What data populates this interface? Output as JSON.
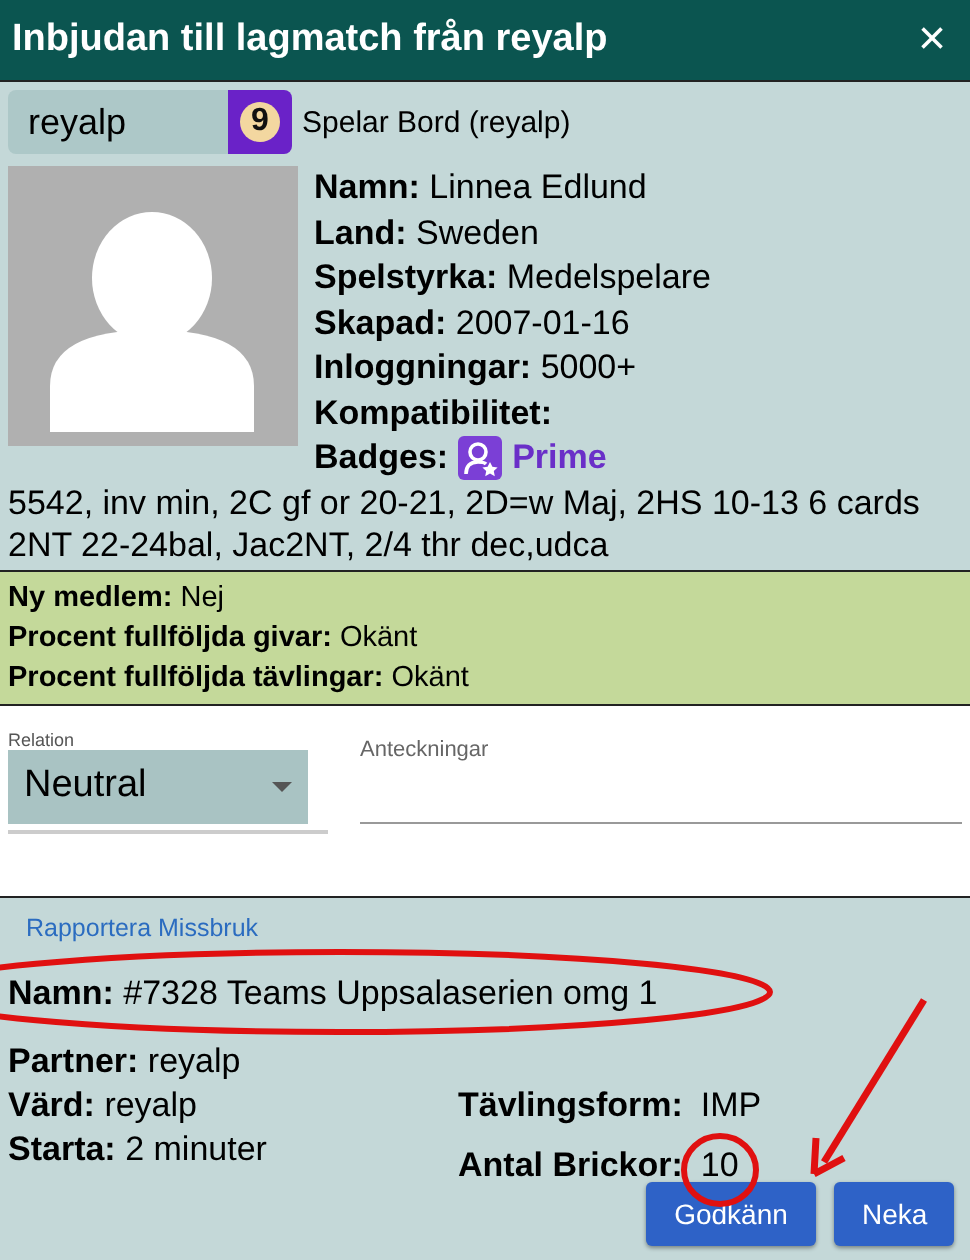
{
  "window": {
    "title": "Inbjudan till lagmatch från reyalp",
    "close": "×"
  },
  "host": {
    "username": "reyalp",
    "level_badge": "9",
    "status": "Spelar Bord (reyalp)"
  },
  "profile": {
    "fields": [
      {
        "label": "Namn:",
        "value": "Linnea Edlund"
      },
      {
        "label": "Land:",
        "value": "Sweden"
      },
      {
        "label": "Spelstyrka:",
        "value": "Medelspelare"
      },
      {
        "label": "Skapad:",
        "value": "2007-01-16"
      },
      {
        "label": "Inloggningar:",
        "value": "5000+"
      },
      {
        "label": "Kompatibilitet:"
      }
    ],
    "badges": {
      "label": "Badges:",
      "name": "Prime"
    },
    "bio": [
      "5542, inv min, 2C gf or 20-21, 2D=w Maj, 2HS 10-13 6 cards",
      "2NT 22-24bal, Jac2NT, 2/4 thr dec,udca"
    ]
  },
  "stats": [
    {
      "label": "Ny medlem:",
      "value": "Nej"
    },
    {
      "label": "Procent fullföljda givar:",
      "value": "Okänt"
    },
    {
      "label": "Procent fullföljda tävlingar:",
      "value": "Okänt"
    }
  ],
  "relation": {
    "label": "Relation",
    "value": "Neutral"
  },
  "notes": {
    "placeholder": "Anteckningar"
  },
  "report_link": "Rapportera Missbruk",
  "event": {
    "left": [
      {
        "label": "Namn:",
        "value": "#7328 Teams Uppsalaserien omg 1"
      },
      {
        "label": "Partner:",
        "value": "reyalp"
      },
      {
        "label": "Värd:",
        "value": "reyalp"
      },
      {
        "label": "Starta:",
        "value": "2 minuter"
      }
    ],
    "right": [
      {
        "label": "Tävlingsform:",
        "value": "IMP"
      },
      {
        "label": "Antal Brickor:",
        "value": "10"
      }
    ]
  },
  "buttons": [
    "Godkänn",
    "Neka"
  ]
}
